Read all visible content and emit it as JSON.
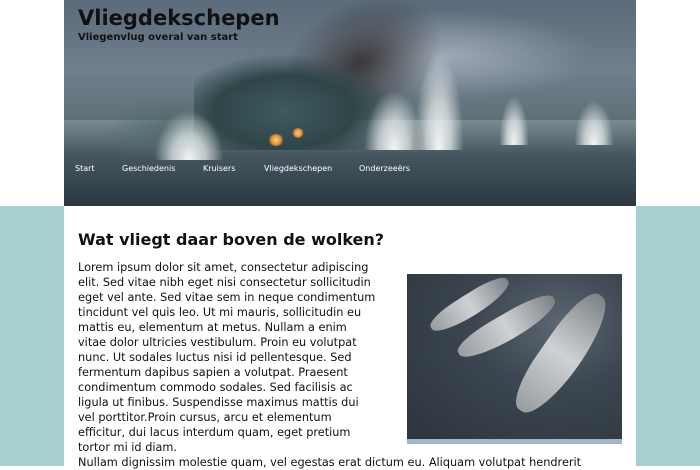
{
  "site": {
    "title": "Vliegdekschepen",
    "subtitle": "Vliegenvlug overal van start"
  },
  "nav": {
    "items": [
      {
        "label": "Start"
      },
      {
        "label": "Geschiedenis"
      },
      {
        "label": "Kruisers"
      },
      {
        "label": "Vliegdekschepen"
      },
      {
        "label": "Onderzeeërs"
      }
    ]
  },
  "main": {
    "heading": "Wat vliegt daar boven de wolken?",
    "paragraph": "Lorem ipsum dolor sit amet, consectetur adipiscing elit. Sed vitae nibh eget nisi consectetur sollicitudin eget vel ante. Sed vitae sem in neque condimentum tincidunt vel quis leo. Ut mi mauris, sollicitudin eu mattis eu, elementum at metus. Nullam a enim vitae dolor ultricies vestibulum. Proin eu volutpat nunc. Ut sodales luctus nisi id pellentesque. Sed fermentum dapibus sapien a volutpat. Praesent condimentum commodo sodales. Sed facilisis ac ligula ut finibus. Suspendisse maximus mattis dui vel porttitor.Proin cursus, arcu et elementum efficitur, dui lacus interdum quam, eget pretium tortor mi id diam.",
    "paragraph_continued": "Nullam dignissim molestie quam, vel egestas erat dictum eu. Aliquam volutpat hendrerit"
  },
  "colors": {
    "background_band": "#a6cfd0",
    "content_bg": "#ffffff",
    "nav_text": "#ffffff"
  },
  "icons": {
    "header_image": "battleship-photo",
    "content_image": "carrier-fleet-photo"
  }
}
